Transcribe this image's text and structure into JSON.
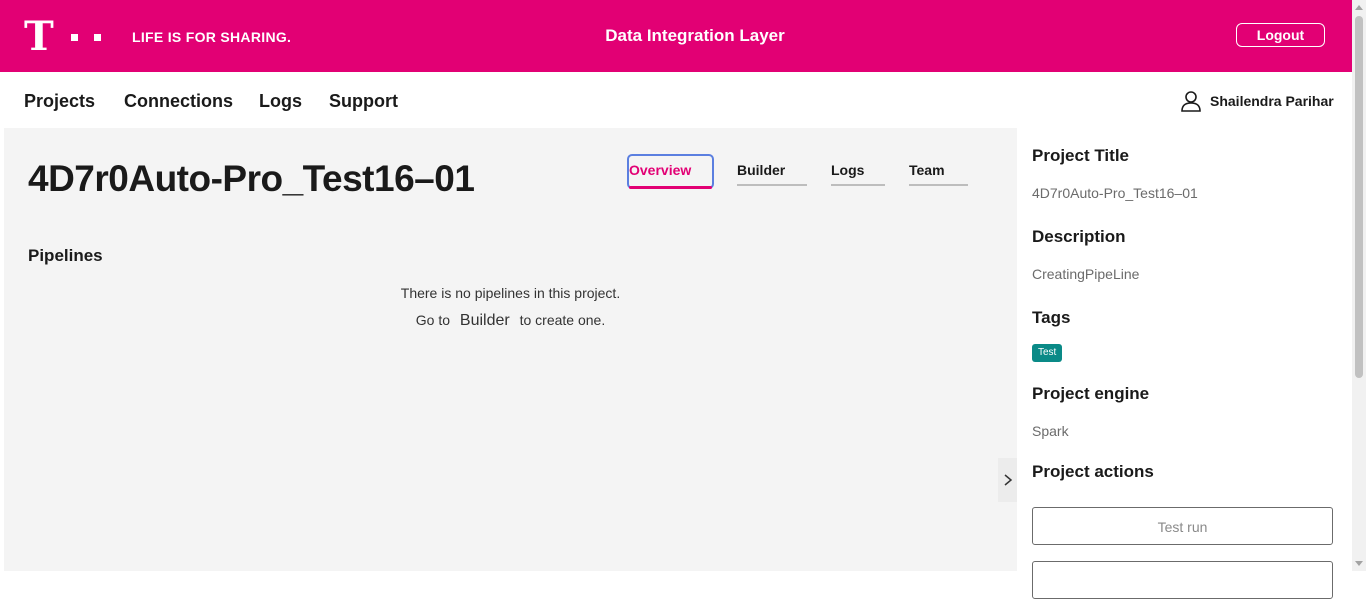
{
  "header": {
    "logo_text": "T",
    "slogan": "LIFE IS FOR SHARING.",
    "app_title": "Data Integration Layer",
    "logout_label": "Logout",
    "brand_color": "#e20074"
  },
  "nav": {
    "items": [
      {
        "label": "Projects"
      },
      {
        "label": "Connections"
      },
      {
        "label": "Logs"
      },
      {
        "label": "Support"
      }
    ],
    "user_icon": "user-icon",
    "user_name": "Shailendra Parihar"
  },
  "project": {
    "title": "4D7r0Auto-Pro_Test16–01",
    "tabs": [
      {
        "label": "Overview",
        "active": true
      },
      {
        "label": "Builder"
      },
      {
        "label": "Logs"
      },
      {
        "label": "Team"
      }
    ],
    "pipelines_heading": "Pipelines",
    "empty_message": "There is no pipelines in this project.",
    "goto_prefix": "Go to",
    "builder_link": "Builder",
    "goto_suffix": "to create one.",
    "collapse_icon": "chevron-right-icon"
  },
  "side_panel": {
    "title_heading": "Project Title",
    "title_value": "4D7r0Auto-Pro_Test16–01",
    "description_heading": "Description",
    "description_value": "CreatingPipeLine",
    "tags_heading": "Tags",
    "tags": [
      "Test"
    ],
    "engine_heading": "Project engine",
    "engine_value": "Spark",
    "actions_heading": "Project actions",
    "actions": [
      {
        "label": "Test run"
      },
      {
        "label": ""
      }
    ],
    "tag_color": "#0a8a87"
  }
}
